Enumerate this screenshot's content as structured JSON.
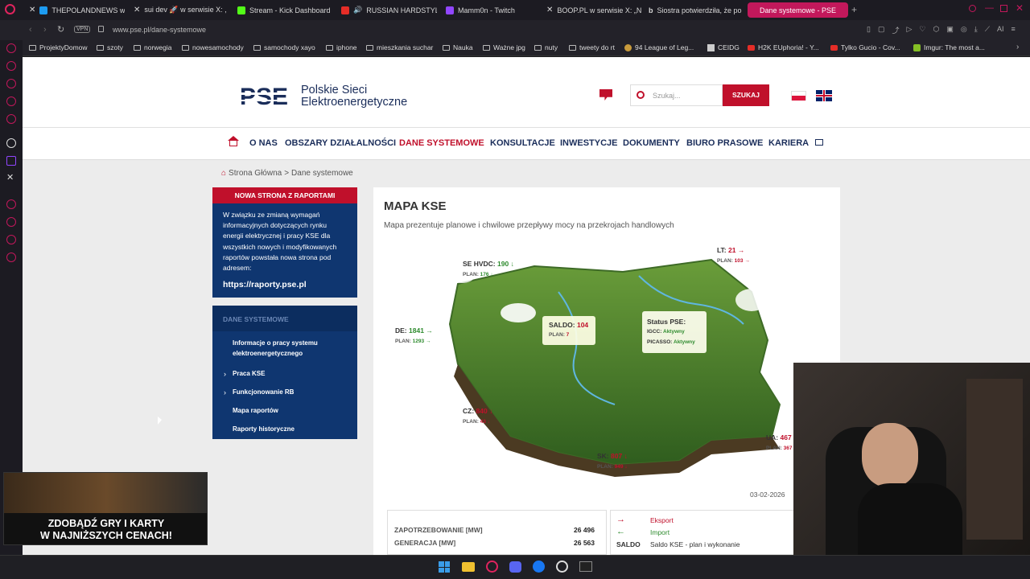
{
  "browser": {
    "tabs": [
      {
        "label": "THEPOLANDNEWS w se"
      },
      {
        "label": "sui dev 🚀 w serwisie X: ,"
      },
      {
        "label": "Stream - Kick Dashboard"
      },
      {
        "label": "RUSSIAN HARDSTYLE"
      },
      {
        "label": "Mamm0n - Twitch"
      },
      {
        "label": "BOOP.PL w serwisie X: „N"
      },
      {
        "label": "Siostra potwierdziła, że po"
      },
      {
        "label": "Dane systemowe - PSE"
      }
    ],
    "url": "www.pse.pl/dane-systemowe",
    "vpn": "VPN",
    "bookmarks": [
      "ProjektyDomow",
      "szoty",
      "norwegia",
      "nowesamochody",
      "samochody xayo",
      "iphone",
      "mieszkania suchar",
      "Nauka",
      "Ważne jpg",
      "nuty",
      "tweety do rt",
      "94 League of Leg...",
      "CEIDG",
      "H2K EUphoria! - Y...",
      "Tylko Gucio - Cov...",
      "Imgur: The most a..."
    ],
    "ai_label": "AI"
  },
  "header": {
    "logo_text": "PSE",
    "org_line1": "Polskie Sieci",
    "org_line2": "Elektroenergetyczne",
    "search_placeholder": "Szukaj...",
    "search_button": "SZUKAJ"
  },
  "nav": {
    "items": [
      "O NAS",
      "OBSZARY DZIAŁALNOŚCI",
      "DANE SYSTEMOWE",
      "KONSULTACJE",
      "INWESTYCJE",
      "DOKUMENTY",
      "BIURO PRASOWE",
      "KARIERA"
    ]
  },
  "breadcrumb": {
    "home": "Strona Główna",
    "sep": ">",
    "current": "Dane systemowe"
  },
  "notice": {
    "title": "NOWA STRONA Z RAPORTAMI",
    "body": "W związku ze zmianą wymagań informacyjnych dotyczących rynku energii elektrycznej i pracy KSE dla wszystkich nowych i modyfikowanych raportów powstała nowa strona pod adresem:",
    "link": "https://raporty.pse.pl"
  },
  "ds_menu": {
    "title": "DANE SYSTEMOWE",
    "items": [
      "Informacje o pracy systemu elektroenergetycznego",
      "Praca KSE",
      "Funkcjonowanie RB",
      "Mapa raportów",
      "Raporty historyczne"
    ]
  },
  "map": {
    "title": "MAPA KSE",
    "subtitle": "Mapa prezentuje planowe i chwilowe przepływy mocy na przekrojach handlowych",
    "flows": {
      "se": {
        "label": "SE HVDC:",
        "value": "190",
        "plan_label": "PLAN:",
        "plan": "176"
      },
      "lt": {
        "label": "LT:",
        "value": "21",
        "plan_label": "PLAN:",
        "plan": "103"
      },
      "de": {
        "label": "DE:",
        "value": "1841",
        "plan_label": "PLAN:",
        "plan": "1293"
      },
      "cz": {
        "label": "CZ:",
        "value": "840",
        "plan_label": "PLAN:",
        "plan": "43"
      },
      "sk": {
        "label": "SK:",
        "value": "807",
        "plan_label": "PLAN:",
        "plan": "949"
      },
      "ua": {
        "label": "UA:",
        "value": "467",
        "plan_label": "PLAN:",
        "plan": "367"
      }
    },
    "saldo": {
      "label": "SALDO:",
      "value": "104",
      "plan_label": "PLAN:",
      "plan": "7"
    },
    "status": {
      "title": "Status PSE:",
      "igcc_label": "IGCC:",
      "igcc": "Aktywny",
      "picasso_label": "PICASSO:",
      "picasso": "Aktywny"
    },
    "date": "03-02-2026"
  },
  "summary": {
    "rows": [
      {
        "label": "ZAPOTRZEBOWANIE [MW]",
        "value": "26 496"
      },
      {
        "label": "GENERACJA [MW]",
        "value": "26 563"
      }
    ]
  },
  "legend": {
    "export": "Eksport",
    "import": "Import",
    "saldo_label": "SALDO",
    "saldo_desc": "Saldo KSE - plan i wykonanie"
  },
  "ad": {
    "line1": "ZDOBĄDŹ GRY I KARTY",
    "line2": "W NAJNIŻSZYCH CENACH!"
  },
  "colors": {
    "brand_red": "#c0102b",
    "brand_navy": "#0f3670",
    "accent_browser": "#c2185b"
  }
}
